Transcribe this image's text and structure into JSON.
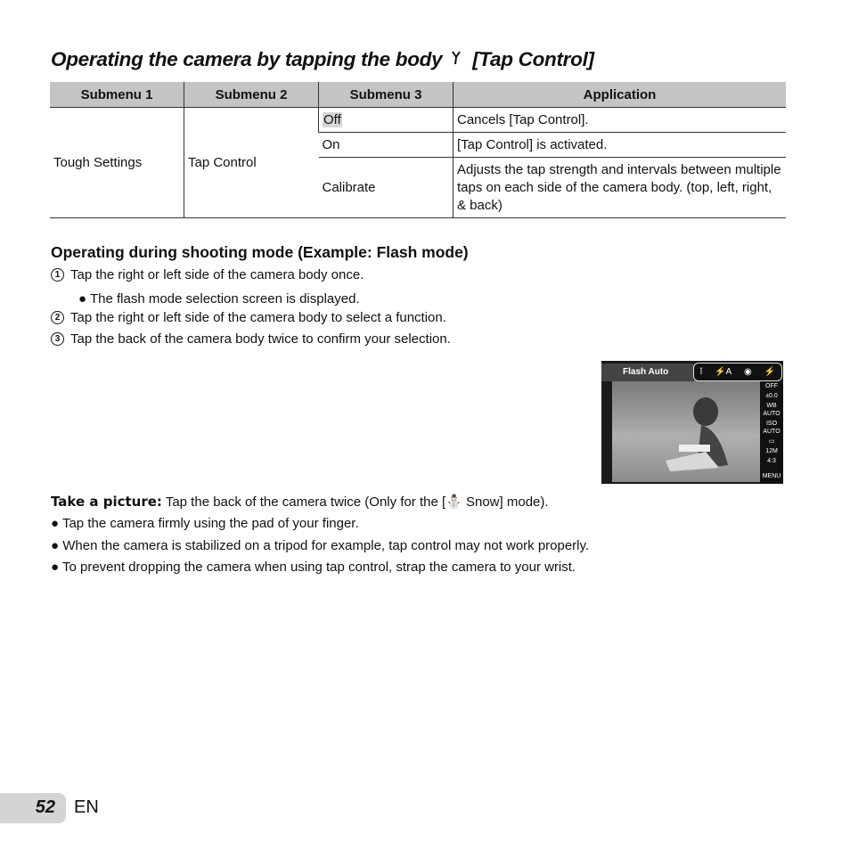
{
  "title": {
    "text_before": "Operating the camera by tapping the body",
    "icon": "tap-control-icon",
    "text_after": "[Tap Control]"
  },
  "table": {
    "headers": [
      "Submenu 1",
      "Submenu 2",
      "Submenu 3",
      "Application"
    ],
    "submenu1": "Tough Settings",
    "submenu2": "Tap Control",
    "rows": [
      {
        "submenu3": "Off",
        "application": "Cancels [Tap Control].",
        "highlighted": true
      },
      {
        "submenu3": "On",
        "application": "[Tap Control] is activated."
      },
      {
        "submenu3": "Calibrate",
        "application": "Adjusts the tap strength and intervals between multiple taps on each side of the camera body. (top, left, right, & back)"
      }
    ]
  },
  "section": {
    "heading": "Operating during shooting mode (Example: Flash mode)",
    "steps": [
      {
        "num": "1",
        "text": "Tap the right or left side of the camera body once."
      },
      {
        "num": "2",
        "text": "Tap the right or left side of the camera body to select a function."
      },
      {
        "num": "3",
        "text": "Tap the back of the camera body twice to confirm your selection."
      }
    ],
    "step1_note": "The flash mode selection screen is displayed."
  },
  "camera_screen": {
    "label": "Flash Auto",
    "top_icons": [
      "tap-icon",
      "flash-auto-icon",
      "red-eye-icon",
      "flash-icon"
    ],
    "side_items": [
      "OFF",
      "±0.0",
      "WB AUTO",
      "ISO AUTO",
      "▭",
      "12M",
      "4:3",
      "MENU"
    ]
  },
  "take_picture": {
    "label": "Take a picture:",
    "text_before": "Tap the back of the camera twice (Only for the [",
    "icon": "snow-mode-icon",
    "text_after": " Snow] mode)."
  },
  "notes": [
    "Tap the camera firmly using the pad of your finger.",
    "When the camera is stabilized on a tripod for example, tap control may not work properly.",
    "To prevent dropping the camera when using tap control, strap the camera to your wrist."
  ],
  "footer": {
    "page": "52",
    "lang": "EN"
  }
}
